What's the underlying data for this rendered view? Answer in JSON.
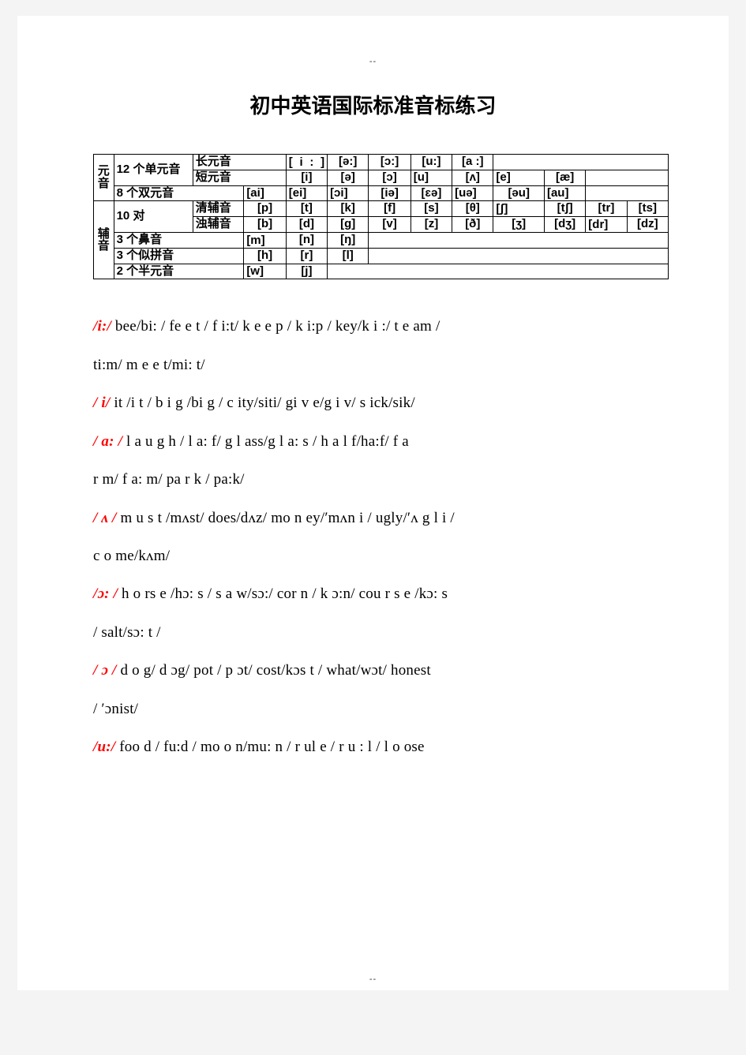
{
  "page": {
    "header_mark": "--",
    "footer_mark": "--",
    "title": "初中英语国际标准音标练习"
  },
  "table": {
    "row_labels": {
      "vowel": "元音",
      "consonant": "辅音"
    },
    "groups": {
      "monophthongs": "12 个单元音",
      "diphthongs": "8 个双元音",
      "pairs": "10 对",
      "nasals": "3 个鼻音",
      "pinyin_like": "3 个似拼音",
      "semivowels": "2 个半元音"
    },
    "subgroups": {
      "long_vowel": "长元音",
      "short_vowel": "短元音",
      "voiceless": "清辅音",
      "voiced": "浊辅音"
    },
    "long_vowels": [
      "[ i : ]",
      "[ə:]",
      "[ɔ:]",
      "[u:]",
      "[a :]"
    ],
    "short_vowels": [
      "[i]",
      "[ə]",
      "[ɔ]",
      "[u]",
      "[ʌ]",
      "[e]",
      "[æ]"
    ],
    "diphthongs": [
      "[ai]",
      "[ei]",
      "[ɔi]",
      "[iə]",
      "[ɛə]",
      "[uə]",
      "[əu]",
      "[au]"
    ],
    "voiceless_consonants": [
      "[p]",
      "[t]",
      "[k]",
      "[f]",
      "[s]",
      "[θ]",
      "[ʃ]",
      "[tʃ]",
      "[tr]",
      "[ts]"
    ],
    "voiced_consonants": [
      "[b]",
      "[d]",
      "[g]",
      "[v]",
      "[z]",
      "[ð]",
      "[ʒ]",
      "[dʒ]",
      "[dr]",
      "[dz]"
    ],
    "nasal_consonants": [
      "[m]",
      "[n]",
      "[ŋ]"
    ],
    "pinyin_consonants": [
      "[h]",
      "[r]",
      "[l]"
    ],
    "semivowel_consonants": [
      "[w]",
      "[j]"
    ]
  },
  "practice": [
    {
      "symbol": "/i:/",
      "words": "bee/bi: /   fe e t / f i:t/   k e e p / k i:p /      key/k i :/   t e am /"
    },
    {
      "symbol": "",
      "words": "ti:m/    m e e t/mi:  t/"
    },
    {
      "symbol": "/ i/",
      "words": "it /i t  /    b i  g /bi g /   c ity/siti/   gi v e/g i  v/    s ick/sik/"
    },
    {
      "symbol": "/ a: /",
      "words": "l a u g h /  l a: f/    g l ass/g l a: s /      h a l f/ha:f/      f a"
    },
    {
      "symbol": "",
      "words": "r m/ f a:  m/    pa r k / pa:k/"
    },
    {
      "symbol": "/ ʌ /",
      "words": "m u s t /mʌst/    does/dʌz/    mo n ey/′mʌn i /        ugly/′ʌ g l i /"
    },
    {
      "symbol": "",
      "words": "c o me/kʌm/"
    },
    {
      "symbol": "/ɔ: /",
      "words": "h o rs e /hɔ:   s /   s a w/sɔ:/     cor n / k ɔ:n/   cou r  s  e /kɔ: s"
    },
    {
      "symbol": "",
      "words": "/     salt/sɔ: t /"
    },
    {
      "symbol": "/ ɔ  /",
      "words": "d  o g/ d ɔg/     pot /  p ɔt/     cost/kɔs t /   what/wɔt/      honest"
    },
    {
      "symbol": "",
      "words": "/ ′ɔnist/"
    },
    {
      "symbol": "/u:/",
      "words": "foo d  / fu:d /     mo o n/mu: n /       r ul e / r u : l /   l o ose"
    }
  ]
}
